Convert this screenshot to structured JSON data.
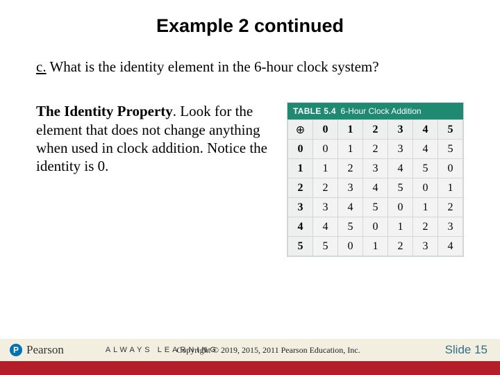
{
  "title": "Example 2 continued",
  "question": {
    "label": "c.",
    "text": " What is the identity element in the 6-hour clock system?"
  },
  "para": {
    "lead": "The Identity Property",
    "rest": ". Look for the element that does not change anything when used in clock addition. Notice the identity is 0."
  },
  "table": {
    "label": "TABLE 5.4",
    "caption": "6-Hour Clock Addition",
    "corner": "⊕",
    "headers": [
      "0",
      "1",
      "2",
      "3",
      "4",
      "5"
    ],
    "rows": [
      {
        "h": "0",
        "v": [
          "0",
          "1",
          "2",
          "3",
          "4",
          "5"
        ]
      },
      {
        "h": "1",
        "v": [
          "1",
          "2",
          "3",
          "4",
          "5",
          "0"
        ]
      },
      {
        "h": "2",
        "v": [
          "2",
          "3",
          "4",
          "5",
          "0",
          "1"
        ]
      },
      {
        "h": "3",
        "v": [
          "3",
          "4",
          "5",
          "0",
          "1",
          "2"
        ]
      },
      {
        "h": "4",
        "v": [
          "4",
          "5",
          "0",
          "1",
          "2",
          "3"
        ]
      },
      {
        "h": "5",
        "v": [
          "5",
          "0",
          "1",
          "2",
          "3",
          "4"
        ]
      }
    ]
  },
  "footer": {
    "brand": "Pearson",
    "brand_mark": "P",
    "tagline": "ALWAYS LEARNING",
    "copyright": "Copyright © 2019, 2015, 2011 Pearson Education, Inc.",
    "slide": "Slide 15"
  }
}
